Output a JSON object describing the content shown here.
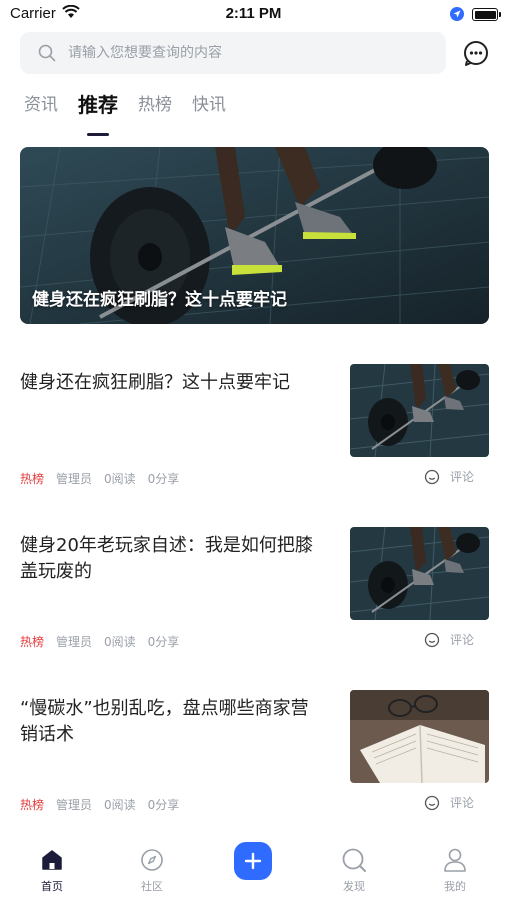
{
  "status_bar": {
    "carrier": "Carrier",
    "time": "2:11 PM"
  },
  "search": {
    "placeholder": "请输入您想要查询的内容",
    "value": ""
  },
  "tabs": [
    {
      "label": "资讯",
      "active": false
    },
    {
      "label": "推荐",
      "active": true
    },
    {
      "label": "热榜",
      "active": false
    },
    {
      "label": "快讯",
      "active": false
    }
  ],
  "banner": {
    "title": "健身还在疯狂刷脂？这十点要牢记"
  },
  "articles": [
    {
      "title": "健身还在疯狂刷脂？这十点要牢记",
      "tag": "热榜",
      "author": "管理员",
      "reads": "0阅读",
      "shares": "0分享",
      "comment_label": "评论",
      "image": "barbell-workout"
    },
    {
      "title": "健身20年老玩家自述：我是如何把膝盖玩废的",
      "tag": "热榜",
      "author": "管理员",
      "reads": "0阅读",
      "shares": "0分享",
      "comment_label": "评论",
      "image": "barbell-workout"
    },
    {
      "title": "“慢碳水”也别乱吃，盘点哪些商家营销话术",
      "tag": "热榜",
      "author": "管理员",
      "reads": "0阅读",
      "shares": "0分享",
      "comment_label": "评论",
      "image": "open-book-glasses"
    }
  ],
  "bottom_nav": {
    "items": [
      {
        "label": "首页",
        "icon": "home-icon",
        "active": true
      },
      {
        "label": "社区",
        "icon": "compass-icon",
        "active": false
      },
      {
        "label": "",
        "icon": "plus-icon",
        "active": false
      },
      {
        "label": "发现",
        "icon": "discover-search-icon",
        "active": false
      },
      {
        "label": "我的",
        "icon": "user-icon",
        "active": false
      }
    ]
  },
  "colors": {
    "accent": "#2f6bff",
    "hot_tag": "#e23c3c",
    "active_text": "#1c1c3a",
    "muted": "#9aa0a8"
  }
}
